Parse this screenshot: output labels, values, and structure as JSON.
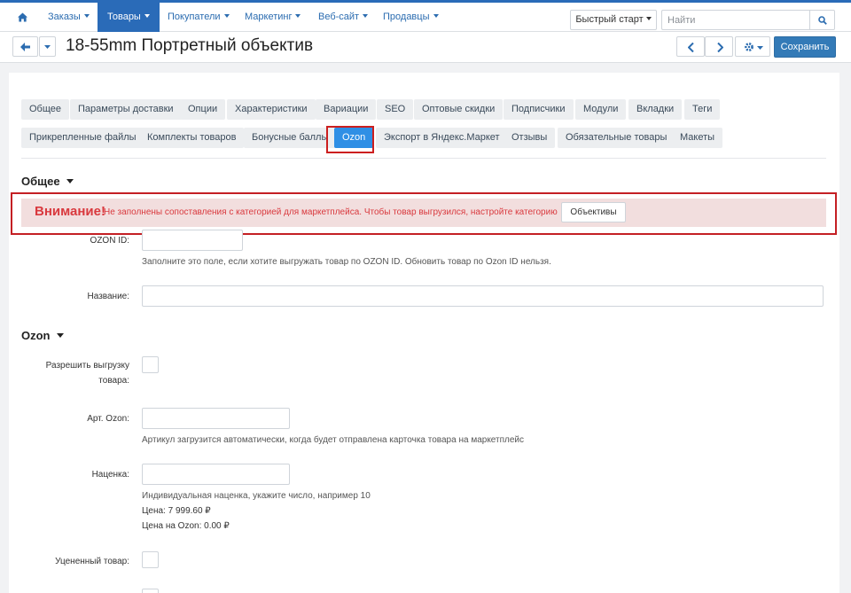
{
  "nav": {
    "items": [
      {
        "label": "Заказы"
      },
      {
        "label": "Товары"
      },
      {
        "label": "Покупатели"
      },
      {
        "label": "Маркетинг"
      },
      {
        "label": "Веб-сайт"
      },
      {
        "label": "Продавцы"
      }
    ],
    "active_item": "Товары",
    "quick_start": "Быстрый старт",
    "search_placeholder": "Найти"
  },
  "toolbar": {
    "title": "18-55mm Портретный объектив",
    "save_label": "Сохранить"
  },
  "tabs": [
    "Общее",
    "Параметры доставки",
    "Опции",
    "Характеристики",
    "Вариации",
    "SEO",
    "Оптовые скидки",
    "Подписчики",
    "Модули",
    "Вкладки",
    "Теги",
    "Прикрепленные файлы",
    "Комплекты товаров",
    "Бонусные баллы",
    "Ozon",
    "Экспорт в Яндекс.Маркет",
    "Отзывы",
    "Обязательные товары",
    "Макеты"
  ],
  "active_tab": "Ozon",
  "general": {
    "title": "Общее",
    "alert": {
      "title": "Внимание!",
      "text": "Не заполнены сопоставления с категорией для маркетплейса. Чтобы товар выгрузился, настройте категорию",
      "button": "Объективы"
    },
    "ozon_id_label": "OZON ID:",
    "ozon_id_value": "",
    "ozon_id_hint": "Заполните это поле, если хотите выгружать товар по OZON ID. Обновить товар по Ozon ID нельзя.",
    "name_label": "Название:",
    "name_value": ""
  },
  "ozon": {
    "title": "Ozon",
    "allow_export_label_1": "Разрешить выгрузку",
    "allow_export_label_2": "товара:",
    "allow_export_checked": false,
    "article_label": "Арт. Ozon:",
    "article_value": "",
    "article_hint": "Артикул загрузится автоматически, когда будет отправлена карточка товара на маркетплейс",
    "markup_label": "Наценка:",
    "markup_value": "",
    "markup_hint": "Индивидуальная наценка, укажите число, например 10",
    "price_text": "Цена: 7 999.60 ₽",
    "ozon_price_text": "Цена на Ozon: 0.00 ₽",
    "discounted_label": "Уцененный товар:",
    "discounted_checked": false
  }
}
